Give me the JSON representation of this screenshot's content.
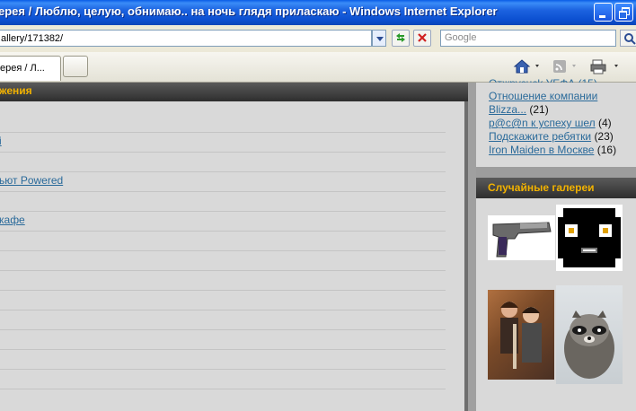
{
  "window": {
    "title": "ерея / Люблю, целую, обнимаю.. на ночь глядя приласкаю - Windows Internet Explorer"
  },
  "address_bar": {
    "url": "allery/171382/",
    "search_placeholder": "Google"
  },
  "tabs": [
    {
      "label": "ерея / Л..."
    }
  ],
  "main": {
    "header": "жения",
    "rows": [
      {
        "link": ""
      },
      {
        "link": "i"
      },
      {
        "link": ""
      },
      {
        "link": "ьют Powered"
      },
      {
        "link": ""
      },
      {
        "link": "кафе"
      },
      {
        "link": ""
      },
      {
        "link": ""
      },
      {
        "link": ""
      },
      {
        "link": ""
      },
      {
        "link": ""
      },
      {
        "link": ""
      },
      {
        "link": ""
      },
      {
        "link": ""
      }
    ]
  },
  "sidebar": {
    "topics": [
      {
        "title": "Отношение компании",
        "count": ""
      },
      {
        "title": "Blizza...",
        "count": "(21)"
      },
      {
        "title": "p@c@n к успеху шел",
        "count": "(4)"
      },
      {
        "title": "Подскажите ребятки",
        "count": "(23)"
      },
      {
        "title": "Iron Maiden в Москве",
        "count": "(16)"
      }
    ],
    "galleries_header": "Случайные галереи",
    "galleries": [
      {
        "icon": "pistol-thumbnail"
      },
      {
        "icon": "black-smiley-thumbnail"
      },
      {
        "icon": "people-photo-thumbnail"
      },
      {
        "icon": "raccoon-thumbnail"
      }
    ]
  },
  "colors": {
    "accent": "#f2b200",
    "link": "#2a6a9a",
    "titlebar": "#0a5de6"
  }
}
